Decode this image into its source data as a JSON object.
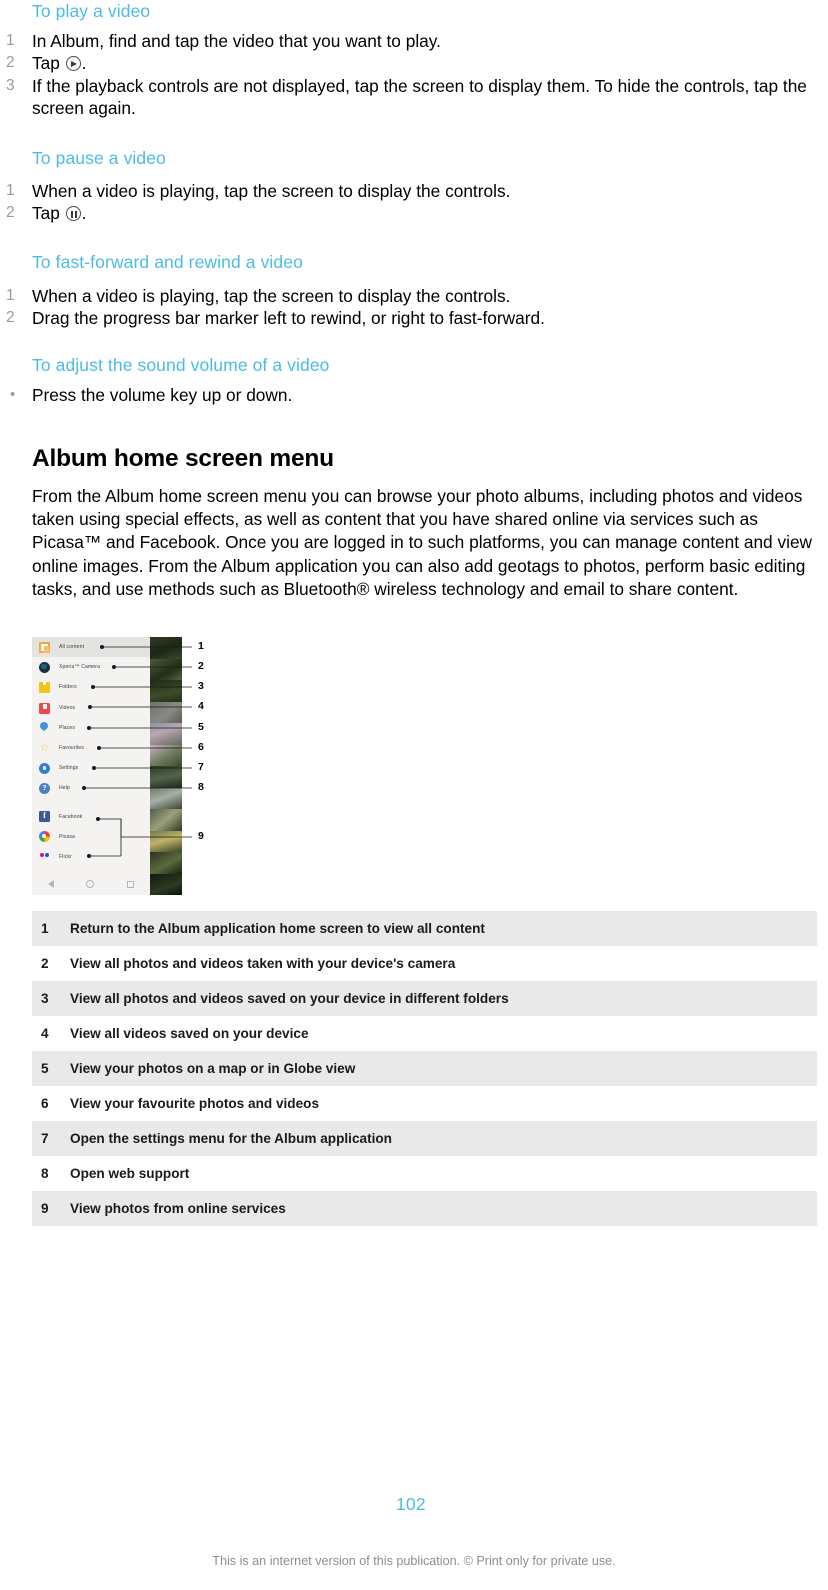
{
  "sections": [
    {
      "heading": "To play a video",
      "list_type": "ordered",
      "steps": [
        {
          "num": "1",
          "text": "In Album, find and tap the video that you want to play."
        },
        {
          "num": "2",
          "text_before": "Tap ",
          "icon": "play-icon",
          "text_after": "."
        },
        {
          "num": "3",
          "text": "If the playback controls are not displayed, tap the screen to display them. To hide the controls, tap the screen again."
        }
      ]
    },
    {
      "heading": "To pause a video",
      "list_type": "ordered",
      "steps": [
        {
          "num": "1",
          "text": "When a video is playing, tap the screen to display the controls."
        },
        {
          "num": "2",
          "text_before": "Tap ",
          "icon": "pause-icon",
          "text_after": "."
        }
      ]
    },
    {
      "heading": "To fast-forward and rewind a video",
      "list_type": "ordered",
      "steps": [
        {
          "num": "1",
          "text": "When a video is playing, tap the screen to display the controls."
        },
        {
          "num": "2",
          "text": "Drag the progress bar marker left to rewind, or right to fast-forward."
        }
      ]
    },
    {
      "heading": "To adjust the sound volume of a video",
      "list_type": "bulleted",
      "steps": [
        {
          "num": "•",
          "text": "Press the volume key up or down."
        }
      ]
    }
  ],
  "album_section": {
    "title": "Album home screen menu",
    "paragraph": "From the Album home screen menu you can browse your photo albums, including photos and videos taken using special effects, as well as content that you have shared online via services such as Picasa™ and Facebook. Once you are logged in to such platforms, you can manage content and view online images. From the Album application you can also add geotags to photos, perform basic editing tasks, and use methods such as Bluetooth® wireless technology and email to share content."
  },
  "figure": {
    "drawer_items": [
      {
        "label": "All content",
        "icon": "all-content-icon",
        "selected": true,
        "callout": "1"
      },
      {
        "label": "Xperia™ Camera",
        "icon": "xperia-camera-icon",
        "selected": false,
        "callout": "2"
      },
      {
        "label": "Folders",
        "icon": "folder-icon",
        "selected": false,
        "callout": "3"
      },
      {
        "label": "Videos",
        "icon": "video-icon",
        "selected": false,
        "callout": "4"
      },
      {
        "label": "Places",
        "icon": "location-pin-icon",
        "selected": false,
        "callout": "5"
      },
      {
        "label": "Favourites",
        "icon": "star-icon",
        "selected": false,
        "callout": "6"
      },
      {
        "label": "Settings",
        "icon": "gear-icon",
        "selected": false,
        "callout": "7"
      },
      {
        "label": "Help",
        "icon": "help-icon",
        "selected": false,
        "callout": "8"
      },
      {
        "label": "Facebook",
        "icon": "facebook-icon",
        "selected": false,
        "callout": "9"
      },
      {
        "label": "Picasa",
        "icon": "picasa-icon",
        "selected": false,
        "callout": "9"
      },
      {
        "label": "Flickr",
        "icon": "flickr-icon",
        "selected": false,
        "callout": "9"
      }
    ],
    "callout_numbers": [
      "1",
      "2",
      "3",
      "4",
      "5",
      "6",
      "7",
      "8",
      "9"
    ],
    "nav_bar": [
      "back-icon",
      "home-icon",
      "recents-icon"
    ]
  },
  "legend": {
    "rows": [
      {
        "num": "1",
        "desc": "Return to the Album application home screen to view all content"
      },
      {
        "num": "2",
        "desc": "View all photos and videos taken with your device's camera"
      },
      {
        "num": "3",
        "desc": "View all photos and videos saved on your device in different folders"
      },
      {
        "num": "4",
        "desc": "View all videos saved on your device"
      },
      {
        "num": "5",
        "desc": "View your photos on a map or in Globe view"
      },
      {
        "num": "6",
        "desc": "View your favourite photos and videos"
      },
      {
        "num": "7",
        "desc": "Open the settings menu for the Album application"
      },
      {
        "num": "8",
        "desc": "Open web support"
      },
      {
        "num": "9",
        "desc": "View photos from online services"
      }
    ]
  },
  "footer": {
    "page_number": "102",
    "note": "This is an internet version of this publication. © Print only for private use."
  },
  "colors": {
    "heading_blue": "#4cbce7",
    "list_number_gray": "#9a9a9a",
    "row_shade": "#e9e9e9",
    "footer_gray": "#8e8e8e"
  }
}
